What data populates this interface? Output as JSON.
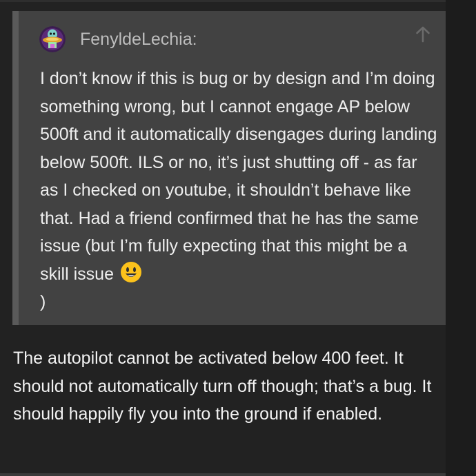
{
  "quote": {
    "author": "FenyldeLechia:",
    "avatar_icon": "alien-ufo-avatar",
    "jump_icon": "arrow-up-icon",
    "text": "I don’t know if this is bug or by design and I’m doing something wrong, but I cannot engage AP below 500ft and it automatically disengages during landing below 500ft. ILS or no, it’s just shutting off - as far as I checked on youtube, it shouldn’t behave like that. Had a friend confirmed that he has the same issue (but I’m fully expecting that this might be a skill issue",
    "emoji": "smiley-emoji",
    "closing": ")"
  },
  "reply": {
    "text": "The autopilot cannot be activated below 400 feet. It should not automatically turn off though; that’s a bug. It should happily fly you into the ground if enabled."
  },
  "colors": {
    "page_bg": "#1c1c1c",
    "post_bg": "#222222",
    "quote_bg": "#424242",
    "quote_border": "#5a5a5a",
    "text": "#eeeeee",
    "muted": "#bdbdbd",
    "emoji": "#fcc21b"
  }
}
